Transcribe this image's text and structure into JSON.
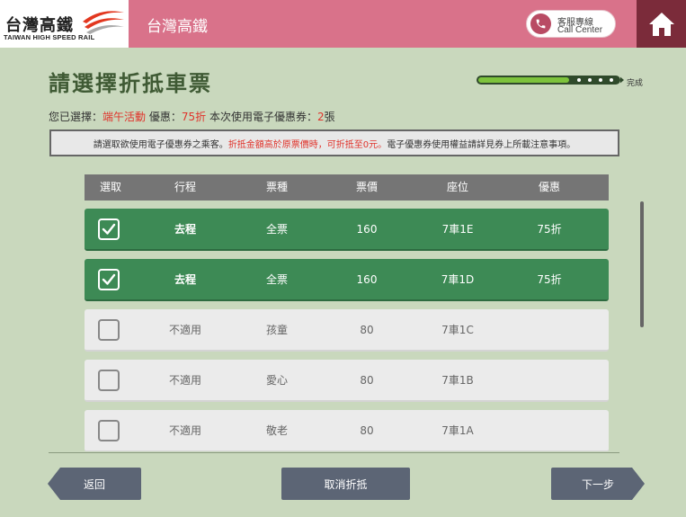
{
  "header": {
    "logo_zh": "台灣高鐵",
    "logo_en": "TAIWAN HIGH SPEED RAIL",
    "app_title": "台灣高鐵",
    "call_center_zh": "客服專線",
    "call_center_en": "Call Center",
    "call_icon": "phone-icon",
    "home_icon": "home-icon"
  },
  "page": {
    "title": "請選擇折抵車票",
    "progress_label": "完成",
    "progress_fraction": 0.65
  },
  "selection": {
    "prefix": "您已選擇：",
    "promo": "端午活動",
    "discount_label": " 優惠：",
    "discount": "75折",
    "coupon_label": " 本次使用電子優惠券：",
    "coupon_count": "2",
    "coupon_unit": "張"
  },
  "notice": {
    "part1": "請選取欲使用電子優惠券之乘客。 ",
    "part2": "折抵金額高於原票價時，可折抵至0元。",
    "part3": " 電子優惠券使用權益請詳見券上所載注意事項。"
  },
  "table": {
    "headers": [
      "選取",
      "行程",
      "票種",
      "票價",
      "座位",
      "優惠"
    ],
    "rows": [
      {
        "selected": true,
        "trip": "去程",
        "ticket_type": "全票",
        "price": "160",
        "seat": "7車1E",
        "discount": "75折"
      },
      {
        "selected": true,
        "trip": "去程",
        "ticket_type": "全票",
        "price": "160",
        "seat": "7車1D",
        "discount": "75折"
      },
      {
        "selected": false,
        "trip": "不適用",
        "ticket_type": "孩童",
        "price": "80",
        "seat": "7車1C",
        "discount": ""
      },
      {
        "selected": false,
        "trip": "不適用",
        "ticket_type": "愛心",
        "price": "80",
        "seat": "7車1B",
        "discount": ""
      },
      {
        "selected": false,
        "trip": "不適用",
        "ticket_type": "敬老",
        "price": "80",
        "seat": "7車1A",
        "discount": ""
      }
    ]
  },
  "buttons": {
    "back": "返回",
    "cancel": "取消折抵",
    "next": "下一步"
  },
  "colors": {
    "header": "#d9728a",
    "home": "#7b2b3a",
    "background": "#c9d8bd",
    "selected_row": "#3d8a55",
    "title": "#3f5a34",
    "highlight": "#e0332b",
    "button": "#5c6575"
  }
}
